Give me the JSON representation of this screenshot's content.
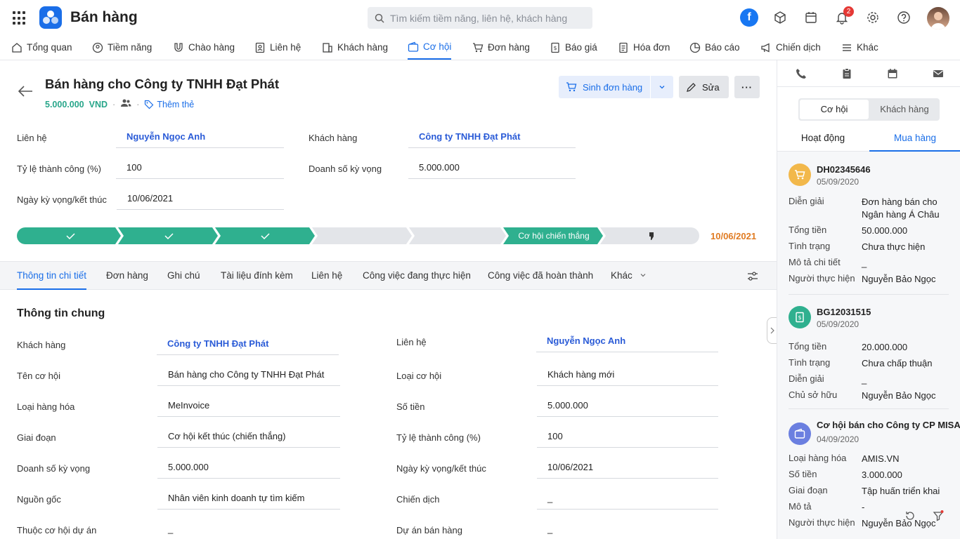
{
  "app": {
    "name": "Bán hàng"
  },
  "search": {
    "placeholder": "Tìm kiếm tiềm năng, liên hệ, khách hàng"
  },
  "notifications": {
    "count": "2"
  },
  "nav": [
    {
      "label": "Tổng quan",
      "icon": "home-icon"
    },
    {
      "label": "Tiềm năng",
      "icon": "lead-icon"
    },
    {
      "label": "Chào hàng",
      "icon": "magnet-icon"
    },
    {
      "label": "Liên hệ",
      "icon": "contact-icon"
    },
    {
      "label": "Khách hàng",
      "icon": "building-icon"
    },
    {
      "label": "Cơ hội",
      "icon": "wallet-icon"
    },
    {
      "label": "Đơn hàng",
      "icon": "cart-icon"
    },
    {
      "label": "Báo giá",
      "icon": "quote-icon"
    },
    {
      "label": "Hóa đơn",
      "icon": "invoice-icon"
    },
    {
      "label": "Báo cáo",
      "icon": "chart-icon"
    },
    {
      "label": "Chiến dịch",
      "icon": "megaphone-icon"
    },
    {
      "label": "Khác",
      "icon": "menu-icon"
    }
  ],
  "record": {
    "title": "Bán hàng cho Công ty TNHH Đạt Phát",
    "amount": "5.000.000",
    "currency": "VND",
    "add_tag": "Thêm thẻ",
    "create_order": "Sinh đơn hàng",
    "edit": "Sửa"
  },
  "header_fields": {
    "contact_label": "Liên hệ",
    "contact_value": "Nguyễn Ngọc Anh",
    "customer_label": "Khách hàng",
    "customer_value": "Công ty TNHH Đạt Phát",
    "rate_label": "Tỷ lệ thành công (%)",
    "rate_value": "100",
    "revenue_label": "Doanh số kỳ vọng",
    "revenue_value": "5.000.000",
    "date_label": "Ngày kỳ vọng/kết thúc",
    "date_value": "10/06/2021"
  },
  "stages": {
    "won_label": "Cơ hội chiến thắng",
    "date": "10/06/2021",
    "colors": {
      "done": "#2fb08f",
      "pending": "#e3e5e9"
    }
  },
  "tabs": [
    "Thông tin chi tiết",
    "Đơn hàng",
    "Ghi chú",
    "Tài liệu đính kèm",
    "Liên hệ",
    "Công việc đang thực hiện",
    "Công việc đã hoàn thành",
    "Khác"
  ],
  "general": {
    "title": "Thông tin chung",
    "left": [
      {
        "label": "Khách hàng",
        "value": "Công ty TNHH Đạt Phát"
      },
      {
        "label": "Tên cơ hội",
        "value": "Bán hàng cho Công ty TNHH Đạt Phát"
      },
      {
        "label": "Loại hàng hóa",
        "value": "MeInvoice"
      },
      {
        "label": "Giai đoạn",
        "value": "Cơ hội kết thúc (chiến thắng)"
      },
      {
        "label": "Doanh số kỳ vọng",
        "value": "5.000.000"
      },
      {
        "label": "Nguồn gốc",
        "value": "Nhân viên kinh doanh tự tìm kiếm"
      },
      {
        "label": "Thuộc cơ hội dự án",
        "value": "_"
      }
    ],
    "right": [
      {
        "label": "Liên hệ",
        "value": "Nguyễn Ngọc Anh"
      },
      {
        "label": "Loại cơ hội",
        "value": "Khách hàng mới"
      },
      {
        "label": "Số tiền",
        "value": "5.000.000"
      },
      {
        "label": "Tỷ lệ thành công (%)",
        "value": "100"
      },
      {
        "label": "Ngày kỳ vọng/kết thúc",
        "value": "10/06/2021"
      },
      {
        "label": "Chiến dịch",
        "value": "_"
      },
      {
        "label": "Dự án bán hàng",
        "value": "_"
      }
    ]
  },
  "sidebar": {
    "segment": [
      "Cơ hội",
      "Khách hàng"
    ],
    "tabs": [
      "Hoạt động",
      "Mua hàng"
    ],
    "cards": [
      {
        "code": "DH02345646",
        "date": "05/09/2020",
        "icon": "cart-icon",
        "color": "#f2b84b",
        "rows": [
          {
            "k": "Diễn giải",
            "v": "Đơn hàng bán cho Ngân hàng Á Châu"
          },
          {
            "k": "Tổng tiền",
            "v": "50.000.000"
          },
          {
            "k": "Tình trạng",
            "v": "Chưa thực hiện"
          },
          {
            "k": "Mô tả chi tiết",
            "v": "_"
          },
          {
            "k": "Người thực hiện",
            "v": "Nguyễn Bảo Ngọc"
          }
        ]
      },
      {
        "code": "BG12031515",
        "date": "05/09/2020",
        "icon": "quote-icon",
        "color": "#2fb08f",
        "rows": [
          {
            "k": "Tổng tiền",
            "v": "20.000.000"
          },
          {
            "k": "Tình trạng",
            "v": "Chưa chấp thuận"
          },
          {
            "k": "Diễn giải",
            "v": "_"
          },
          {
            "k": "Chủ sở hữu",
            "v": "Nguyễn Bảo Ngọc"
          }
        ]
      },
      {
        "code": "Cơ hội bán cho Công ty CP MISA",
        "date": "04/09/2020",
        "icon": "wallet-icon",
        "color": "#6b7fe0",
        "rows": [
          {
            "k": "Loại hàng hóa",
            "v": "AMIS.VN"
          },
          {
            "k": "Số tiền",
            "v": "3.000.000"
          },
          {
            "k": "Giai đoạn",
            "v": "Tập huấn triển khai"
          },
          {
            "k": "Mô tả",
            "v": "-"
          },
          {
            "k": "Người thực hiện",
            "v": "Nguyễn Bảo Ngọc"
          }
        ]
      }
    ]
  }
}
